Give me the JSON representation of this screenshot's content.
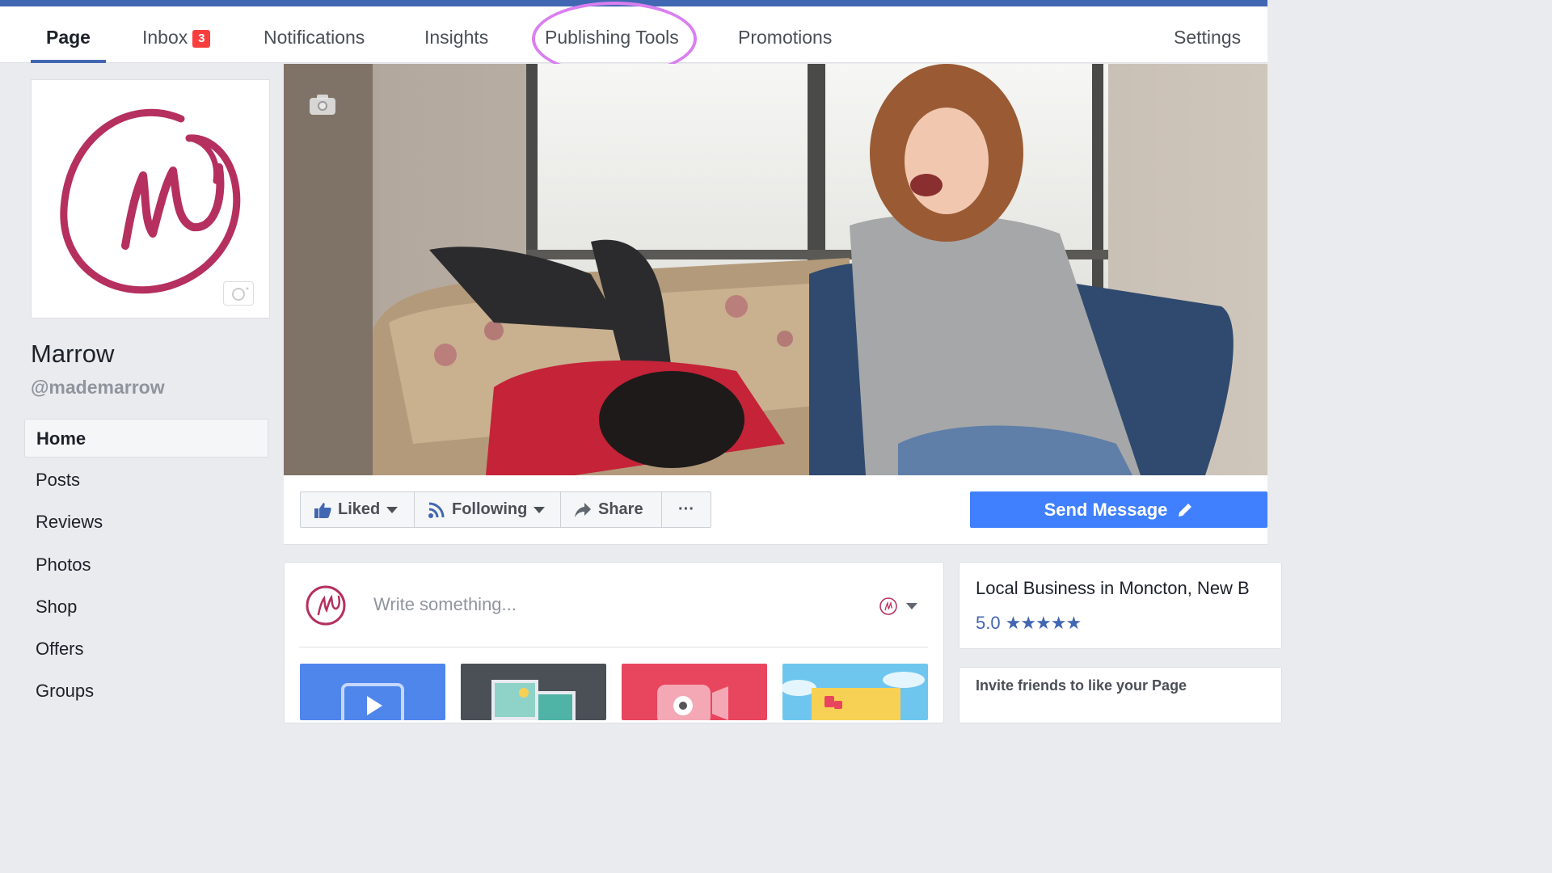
{
  "nav": {
    "tabs": [
      {
        "label": "Page"
      },
      {
        "label": "Inbox",
        "badge": "3"
      },
      {
        "label": "Notifications"
      },
      {
        "label": "Insights"
      },
      {
        "label": "Publishing Tools"
      },
      {
        "label": "Promotions"
      },
      {
        "label": "Settings"
      }
    ],
    "active_tab": "Page",
    "highlighted_tab": "Publishing Tools"
  },
  "profile": {
    "name": "Marrow",
    "handle": "@mademarrow",
    "logo_letter": "M"
  },
  "sidebar": {
    "items": [
      {
        "label": "Home",
        "active": true
      },
      {
        "label": "Posts"
      },
      {
        "label": "Reviews"
      },
      {
        "label": "Photos"
      },
      {
        "label": "Shop"
      },
      {
        "label": "Offers"
      },
      {
        "label": "Groups"
      }
    ]
  },
  "actions": {
    "liked": "Liked",
    "following": "Following",
    "share": "Share",
    "more": "···",
    "send_message": "Send Message"
  },
  "composer": {
    "placeholder": "Write something..."
  },
  "about": {
    "category": "Local Business in Moncton, New B",
    "rating": "5.0",
    "stars": "★★★★★"
  },
  "invite": {
    "title": "Invite friends to like your Page"
  },
  "colors": {
    "brand_blue": "#4267b2",
    "send_button": "#4080ff",
    "logo": "#b5305e",
    "highlight_oval": "#d97ff0",
    "badge": "#fa3e3e"
  }
}
